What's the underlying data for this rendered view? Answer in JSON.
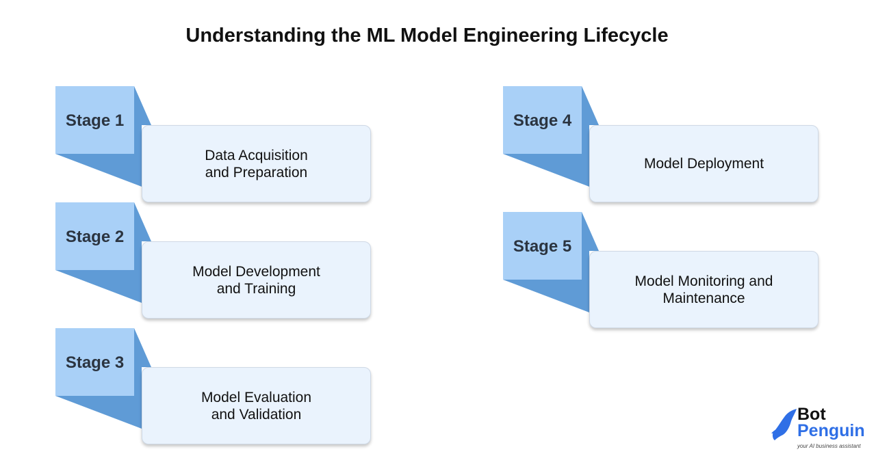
{
  "title": "Understanding the ML Model Engineering Lifecycle",
  "colors": {
    "tab": "#a9d0f7",
    "fold": "#5f9bd6",
    "card": "#eaf3fd",
    "brand_blue": "#2f6fe6"
  },
  "stages": [
    {
      "label": "Stage 1",
      "text": "Data Acquisition\nand Preparation"
    },
    {
      "label": "Stage 2",
      "text": "Model Development\nand Training"
    },
    {
      "label": "Stage 3",
      "text": "Model Evaluation\nand Validation"
    },
    {
      "label": "Stage 4",
      "text": "Model Deployment"
    },
    {
      "label": "Stage 5",
      "text": "Model Monitoring and\nMaintenance"
    }
  ],
  "logo": {
    "line1": "Bot",
    "line2": "Penguin",
    "tagline": "your AI business assistant",
    "icon": "penguin-icon"
  }
}
